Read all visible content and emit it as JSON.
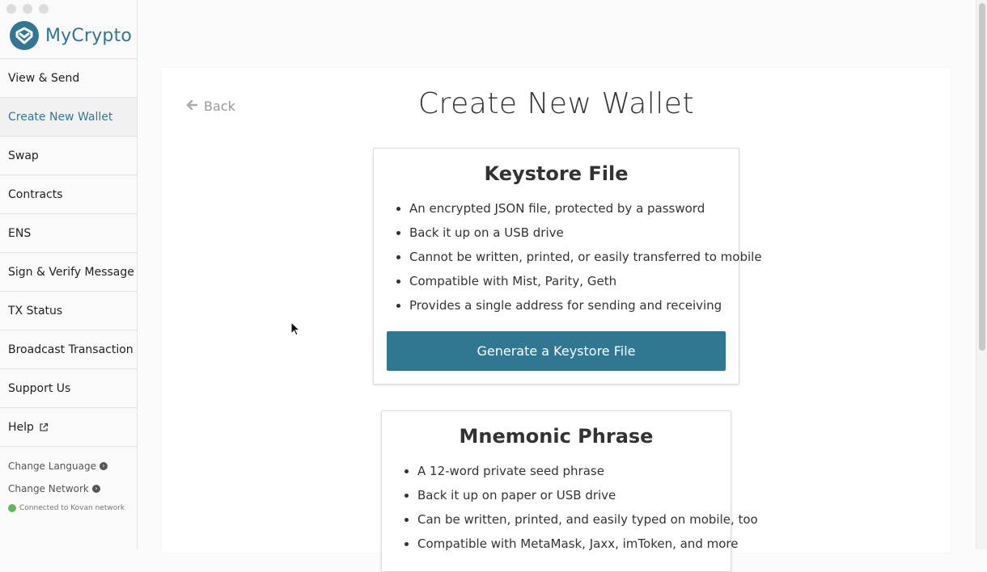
{
  "app": {
    "name": "MyCrypto"
  },
  "sidebar": {
    "items": [
      {
        "label": "View & Send"
      },
      {
        "label": "Create New Wallet",
        "active": true
      },
      {
        "label": "Swap"
      },
      {
        "label": "Contracts"
      },
      {
        "label": "ENS"
      },
      {
        "label": "Sign & Verify Message"
      },
      {
        "label": "TX Status"
      },
      {
        "label": "Broadcast Transaction"
      },
      {
        "label": "Support Us"
      },
      {
        "label": "Help",
        "icon": "external-link-icon"
      }
    ],
    "footer": {
      "change_language": "Change Language",
      "change_network": "Change Network",
      "status": "Connected to Kovan network"
    }
  },
  "main": {
    "back_label": "Back",
    "title": "Create New Wallet",
    "keystore": {
      "title": "Keystore File",
      "bullets": [
        "An encrypted JSON file, protected by a password",
        "Back it up on a USB drive",
        "Cannot be written, printed, or easily transferred to mobile",
        "Compatible with Mist, Parity, Geth",
        "Provides a single address for sending and receiving"
      ],
      "button": "Generate a Keystore File"
    },
    "mnemonic": {
      "title": "Mnemonic Phrase",
      "bullets": [
        "A 12-word private seed phrase",
        "Back it up on paper or USB drive",
        "Can be written, printed, and easily typed on mobile, too",
        "Compatible with MetaMask, Jaxx, imToken, and more"
      ]
    }
  },
  "colors": {
    "accent": "#327792",
    "status_green": "#5dba5a"
  }
}
